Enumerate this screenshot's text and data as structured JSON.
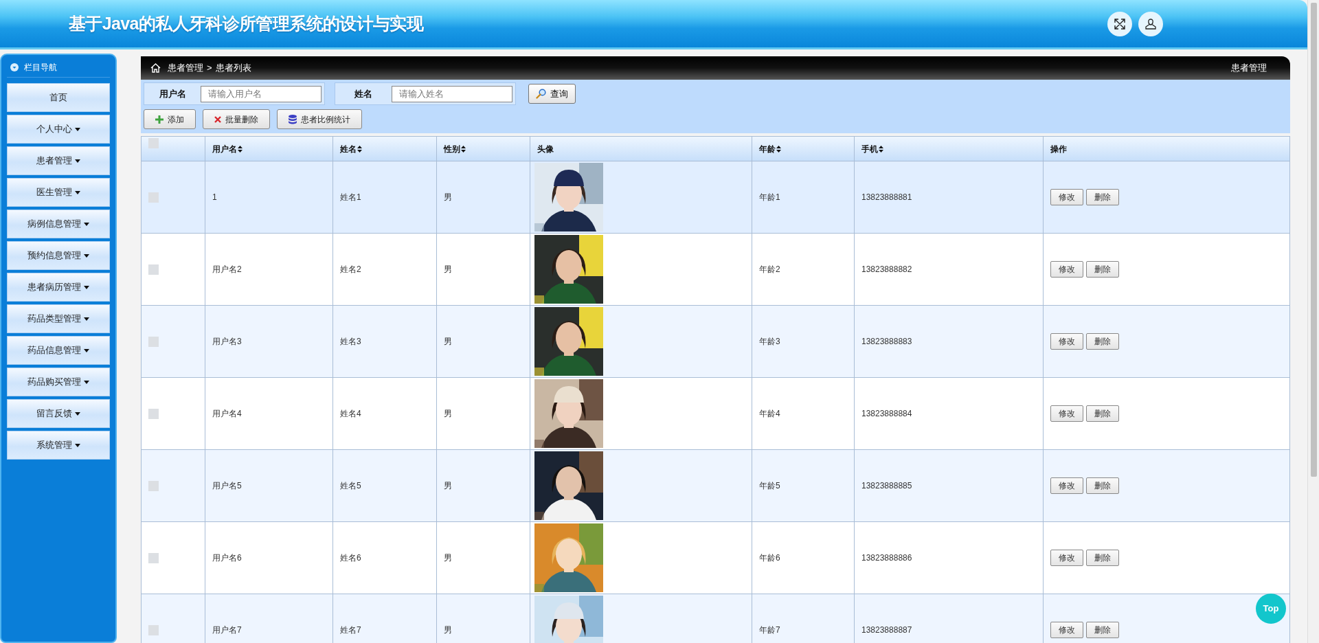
{
  "header": {
    "title": "基于Java的私人牙科诊所管理系统的设计与实现"
  },
  "sidebar": {
    "title": "栏目导航",
    "items": [
      {
        "label": "首页",
        "dropdown": false
      },
      {
        "label": "个人中心",
        "dropdown": true
      },
      {
        "label": "患者管理",
        "dropdown": true
      },
      {
        "label": "医生管理",
        "dropdown": true
      },
      {
        "label": "病例信息管理",
        "dropdown": true
      },
      {
        "label": "预约信息管理",
        "dropdown": true
      },
      {
        "label": "患者病历管理",
        "dropdown": true
      },
      {
        "label": "药品类型管理",
        "dropdown": true
      },
      {
        "label": "药品信息管理",
        "dropdown": true
      },
      {
        "label": "药品购买管理",
        "dropdown": true
      },
      {
        "label": "留言反馈",
        "dropdown": true
      },
      {
        "label": "系统管理",
        "dropdown": true
      }
    ]
  },
  "breadcrumb": {
    "section": "患者管理",
    "separator": ">",
    "page": "患者列表",
    "right_title": "患者管理"
  },
  "search": {
    "fields": [
      {
        "label": "用户名",
        "placeholder": "请输入用户名"
      },
      {
        "label": "姓名",
        "placeholder": "请输入姓名"
      }
    ],
    "button": "查询"
  },
  "actions": [
    {
      "kind": "add",
      "label": "添加"
    },
    {
      "kind": "delete",
      "label": "批量删除"
    },
    {
      "kind": "stats",
      "label": "患者比例统计"
    }
  ],
  "table": {
    "select_all_checked": false,
    "columns": [
      {
        "label": "用户名",
        "sortable": true
      },
      {
        "label": "姓名",
        "sortable": true
      },
      {
        "label": "性别",
        "sortable": true
      },
      {
        "label": "头像",
        "sortable": false
      },
      {
        "label": "年龄",
        "sortable": true
      },
      {
        "label": "手机",
        "sortable": true
      },
      {
        "label": "操作",
        "sortable": false
      }
    ],
    "rows": [
      {
        "checked": false,
        "highlighted": true,
        "username": "1",
        "name": "姓名1",
        "gender": "男",
        "avatar": {
          "kind": "picture"
        },
        "age": "年龄1",
        "phone": "13823888881",
        "buttons": [
          "修改",
          "删除"
        ]
      },
      {
        "checked": false,
        "highlighted": false,
        "username": "用户名2",
        "name": "姓名2",
        "gender": "男",
        "avatar": {
          "kind": "picture"
        },
        "age": "年龄2",
        "phone": "13823888882",
        "buttons": [
          "修改",
          "删除"
        ]
      },
      {
        "checked": false,
        "highlighted": false,
        "username": "用户名3",
        "name": "姓名3",
        "gender": "男",
        "avatar": {
          "kind": "picture"
        },
        "age": "年龄3",
        "phone": "13823888883",
        "buttons": [
          "修改",
          "删除"
        ]
      },
      {
        "checked": false,
        "highlighted": false,
        "username": "用户名4",
        "name": "姓名4",
        "gender": "男",
        "avatar": {
          "kind": "picture"
        },
        "age": "年龄4",
        "phone": "13823888884",
        "buttons": [
          "修改",
          "删除"
        ]
      },
      {
        "checked": false,
        "highlighted": false,
        "username": "用户名5",
        "name": "姓名5",
        "gender": "男",
        "avatar": {
          "kind": "picture"
        },
        "age": "年龄5",
        "phone": "13823888885",
        "buttons": [
          "修改",
          "删除"
        ]
      },
      {
        "checked": false,
        "highlighted": false,
        "username": "用户名6",
        "name": "姓名6",
        "gender": "男",
        "avatar": {
          "kind": "picture"
        },
        "age": "年龄6",
        "phone": "13823888886",
        "buttons": [
          "修改",
          "删除"
        ]
      },
      {
        "checked": false,
        "highlighted": false,
        "username": "用户名7",
        "name": "姓名7",
        "gender": "男",
        "avatar": {
          "kind": "picture"
        },
        "age": "年龄7",
        "phone": "13823888887",
        "buttons": [
          "修改",
          "删除"
        ]
      }
    ]
  },
  "top_button": "Top"
}
